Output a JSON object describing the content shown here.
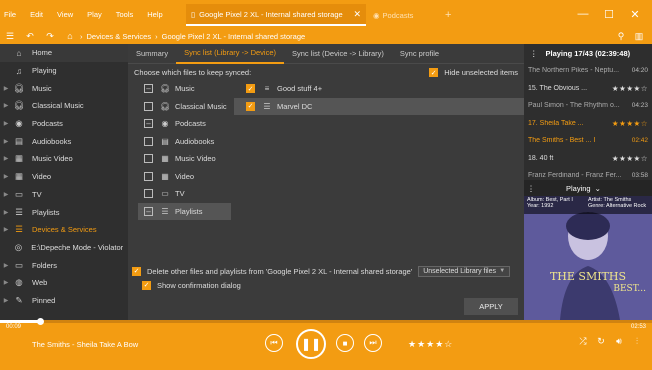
{
  "menu": [
    "File",
    "Edit",
    "View",
    "Play",
    "Tools",
    "Help"
  ],
  "tabs": [
    {
      "label": "Google Pixel 2 XL - Internal shared storage"
    },
    {
      "label": "Podcasts"
    }
  ],
  "breadcrumb": [
    "Devices & Services",
    "Google Pixel 2 XL - Internal shared storage"
  ],
  "sidebar": [
    {
      "label": "Home",
      "icon": "home-icon"
    },
    {
      "label": "Playing",
      "icon": "playing-icon"
    },
    {
      "label": "Music",
      "icon": "headphones-icon"
    },
    {
      "label": "Classical Music",
      "icon": "headphones-icon"
    },
    {
      "label": "Podcasts",
      "icon": "podcast-icon"
    },
    {
      "label": "Audiobooks",
      "icon": "book-icon"
    },
    {
      "label": "Music Video",
      "icon": "film-icon"
    },
    {
      "label": "Video",
      "icon": "film-icon"
    },
    {
      "label": "TV",
      "icon": "tv-icon"
    },
    {
      "label": "Playlists",
      "icon": "list-icon"
    },
    {
      "label": "Devices & Services",
      "icon": "list-icon"
    },
    {
      "label": "E:\\Depeche Mode - Violator",
      "icon": "disc-icon"
    },
    {
      "label": "Folders",
      "icon": "monitor-icon"
    },
    {
      "label": "Web",
      "icon": "globe-icon"
    },
    {
      "label": "Pinned",
      "icon": "pin-icon"
    }
  ],
  "subtabs": [
    "Summary",
    "Sync list (Library -> Device)",
    "Sync list (Device -> Library)",
    "Sync profile"
  ],
  "choose_label": "Choose which files to keep synced:",
  "hide_unselected": "Hide unselected items",
  "types": [
    {
      "label": "Music",
      "icon": "headphones-icon"
    },
    {
      "label": "Classical Music",
      "icon": "headphones-icon"
    },
    {
      "label": "Podcasts",
      "icon": "podcast-icon"
    },
    {
      "label": "Audiobooks",
      "icon": "book-icon"
    },
    {
      "label": "Music Video",
      "icon": "film-icon"
    },
    {
      "label": "Video",
      "icon": "film-icon"
    },
    {
      "label": "TV",
      "icon": "tv-icon"
    },
    {
      "label": "Playlists",
      "icon": "list-icon"
    }
  ],
  "playlists": [
    {
      "label": "Good stuff 4+",
      "icon": "auto-playlist-icon"
    },
    {
      "label": "Marvel DC",
      "icon": "list-icon"
    }
  ],
  "delete_option": "Delete other files and playlists from 'Google Pixel 2 XL - Internal shared storage'",
  "delete_dropdown": "Unselected Library files",
  "confirm_option": "Show confirmation dialog",
  "apply_label": "APPLY",
  "now_playing": {
    "header": "Playing 17/43 (02:39:48)",
    "rows": [
      {
        "title": "The Northern Pikes - Neptu...",
        "duration": "04:20",
        "stars": "",
        "style": "alt"
      },
      {
        "title": "15. The Obvious ...",
        "duration": "",
        "stars": "★★★★☆",
        "style": "normal"
      },
      {
        "title": "Paul Simon - The Rhythm o...",
        "duration": "04:23",
        "stars": "",
        "style": "alt"
      },
      {
        "title": "17. Sheila Take ...",
        "duration": "",
        "stars": "★★★★☆",
        "style": "cur"
      },
      {
        "title": "The Smiths - Best ... I",
        "duration": "02:42",
        "stars": "",
        "style": "curalt"
      },
      {
        "title": "18. 40 ft",
        "duration": "",
        "stars": "★★★★☆",
        "style": "normal"
      },
      {
        "title": "Franz Ferdinand - Franz Fer...",
        "duration": "03:58",
        "stars": "",
        "style": "alt"
      },
      {
        "title": "19. Such Great H...",
        "duration": "",
        "stars": "★★★★☆",
        "style": "normal"
      }
    ],
    "playing_label": "Playing",
    "album_info": {
      "album": "Album: Best, Part I",
      "artist": "Artist: The Smiths",
      "year": "Year: 1992",
      "genre": "Genre: Alternative Rock"
    },
    "art_title": "THE SMITHS",
    "art_subtitle": "BEST..."
  },
  "player": {
    "time_elapsed": "00:09",
    "time_total": "02:53",
    "progress": 0.062,
    "song": "The Smiths - Sheila Take A Bow",
    "rating": 4
  },
  "colors": {
    "accent": "#f39c12"
  }
}
